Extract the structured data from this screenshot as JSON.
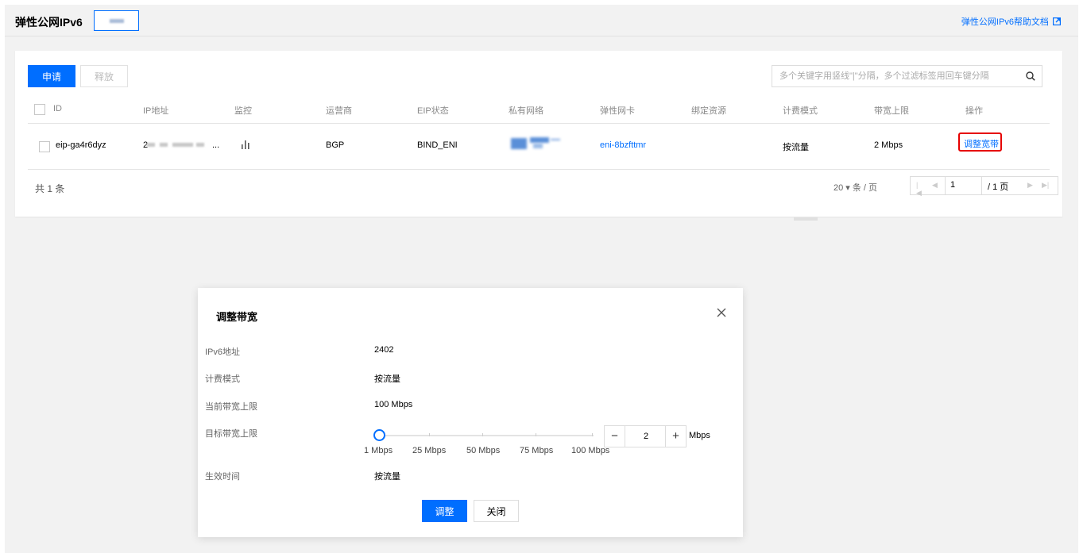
{
  "header": {
    "title": "弹性公网IPv6",
    "help_link": "弹性公网IPv6帮助文档"
  },
  "toolbar": {
    "apply_label": "申请",
    "release_label": "释放",
    "search_placeholder": "多个关键字用竖线\"|\"分隔，多个过滤标签用回车键分隔"
  },
  "table": {
    "columns": [
      "ID",
      "IP地址",
      "监控",
      "运营商",
      "EIP状态",
      "私有网络",
      "弹性网卡",
      "绑定资源",
      "计费模式",
      "带宽上限",
      "操作"
    ],
    "rows": [
      {
        "id": "eip-ga4r6dyz",
        "ip": "2",
        "ip_ellipsis": "...",
        "isp": "BGP",
        "status": "BIND_ENI",
        "eni": "eni-8bzfttmr",
        "billing": "按流量",
        "bandwidth": "2 Mbps",
        "action": "调整宽带"
      }
    ]
  },
  "footer": {
    "total": "共 1 条",
    "page_size": "20 ▾ 条 / 页",
    "page_input": "1",
    "page_total": "/ 1 页"
  },
  "modal": {
    "title": "调整带宽",
    "fields": {
      "ipv6_label": "IPv6地址",
      "ipv6_value": "2402",
      "billing_label": "计费模式",
      "billing_value": "按流量",
      "current_label": "当前带宽上限",
      "current_value": "100 Mbps",
      "target_label": "目标带宽上限",
      "effective_label": "生效时间",
      "effective_value": "按流量"
    },
    "slider": {
      "value": 2,
      "min": 1,
      "max": 100,
      "labels": [
        "1 Mbps",
        "25 Mbps",
        "50 Mbps",
        "75 Mbps",
        "100 Mbps"
      ]
    },
    "stepper": {
      "minus": "−",
      "value": "2",
      "plus": "+",
      "unit": "Mbps"
    },
    "ok_label": "调整",
    "cancel_label": "关闭"
  },
  "colors": {
    "primary": "#006eff",
    "highlight": "#e60000"
  }
}
